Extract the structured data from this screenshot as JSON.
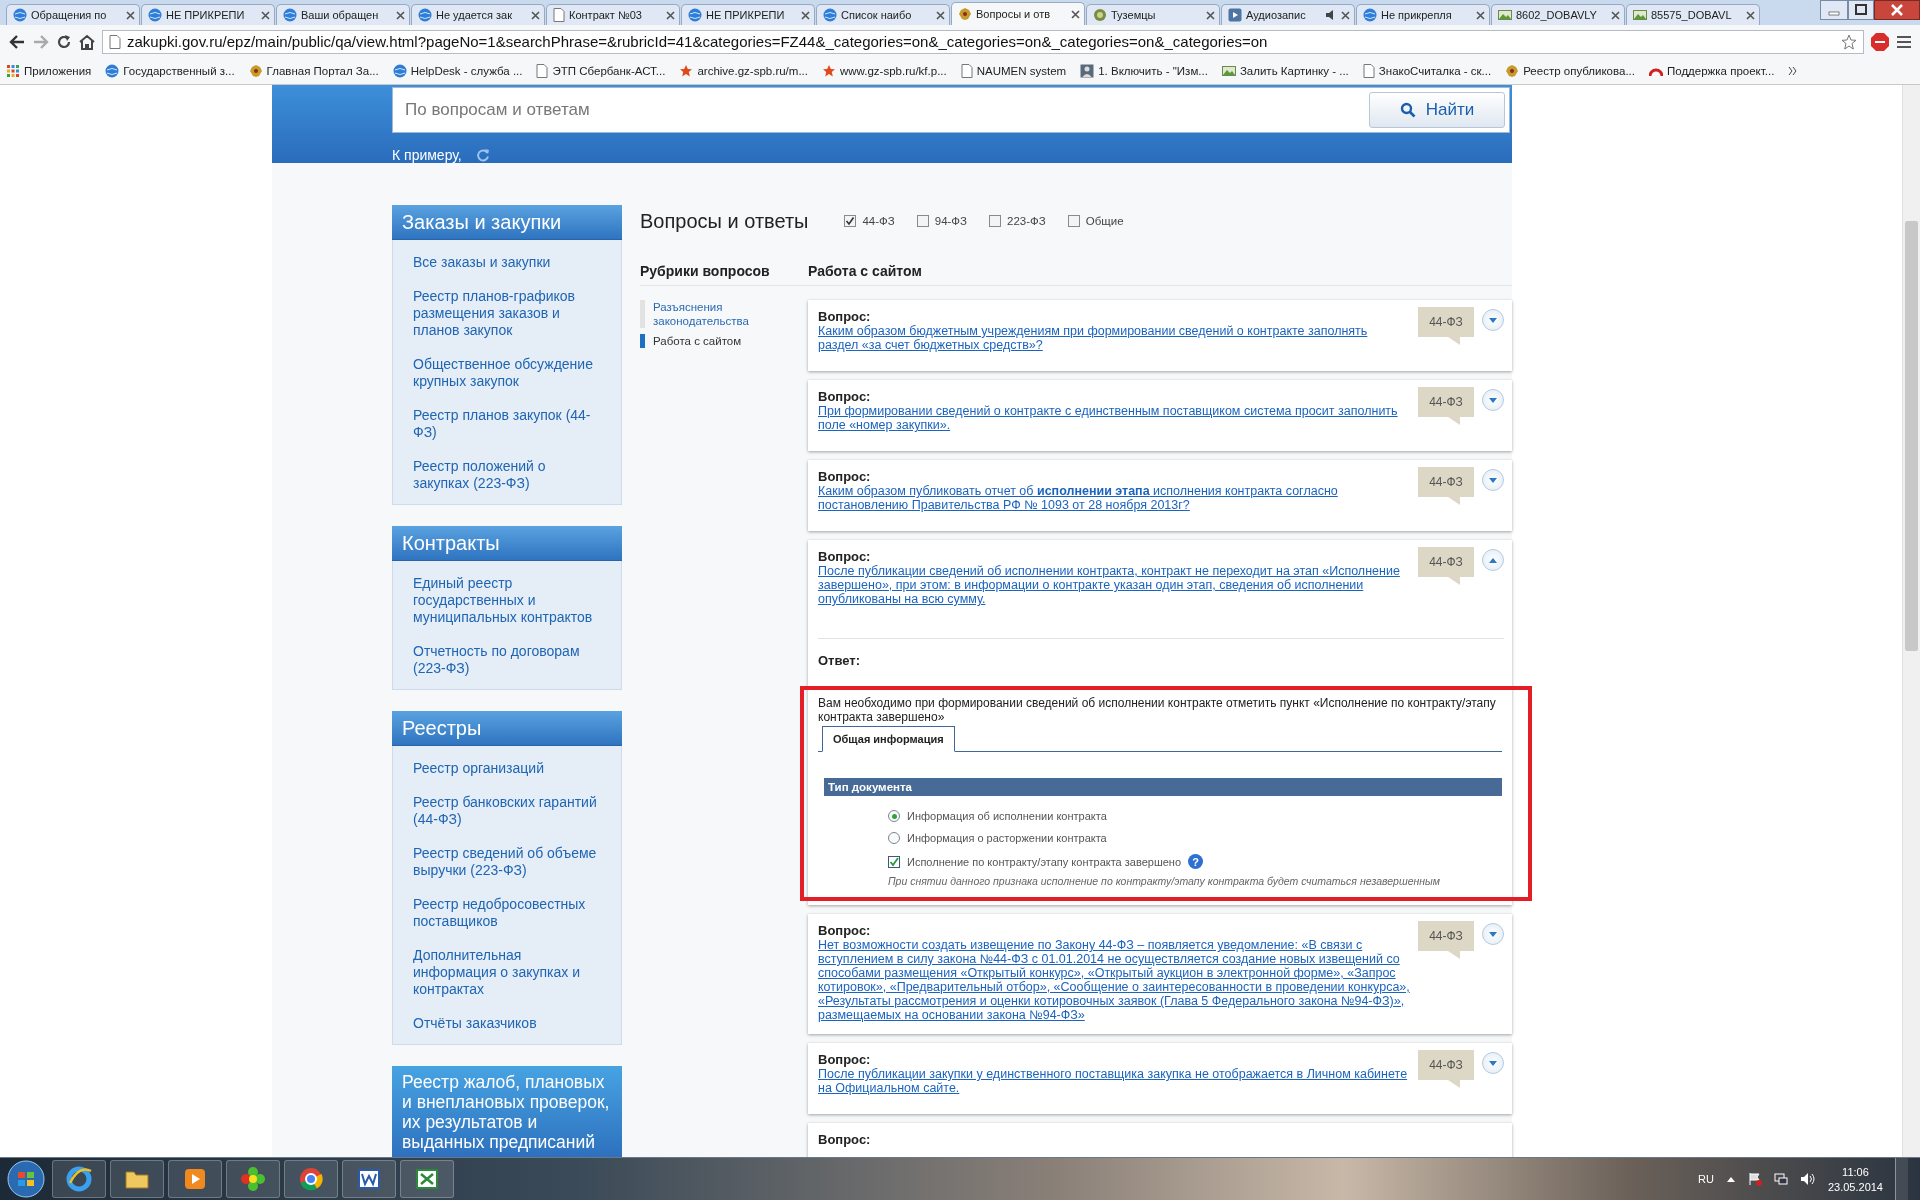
{
  "browser": {
    "tabs": [
      {
        "label": "Обращения по",
        "selected": false
      },
      {
        "label": "НЕ ПРИКРЕПИ",
        "selected": false
      },
      {
        "label": "Ваши обращен",
        "selected": false
      },
      {
        "label": "Не удается зак",
        "selected": false
      },
      {
        "label": "Контракт №03",
        "selected": false
      },
      {
        "label": "НЕ ПРИКРЕПИ",
        "selected": false
      },
      {
        "label": "Список наибо",
        "selected": false
      },
      {
        "label": "Вопросы и отв",
        "selected": true
      },
      {
        "label": "Туземцы",
        "selected": false
      },
      {
        "label": "Аудиозапис",
        "selected": false
      },
      {
        "label": "Не прикрепля",
        "selected": false
      },
      {
        "label": "8602_DOBAVLY",
        "selected": false
      },
      {
        "label": "85575_DOBAVL",
        "selected": false
      }
    ],
    "url": "zakupki.gov.ru/epz/main/public/qa/view.html?pageNo=1&searchPhrase=&rubricId=41&categories=FZ44&_categories=on&_categories=on&_categories=on&_categories=on",
    "bookmarks": [
      "Приложения",
      "Государственный з...",
      "Главная Портал За...",
      "HelpDesk - служба ...",
      "ЭТП Сбербанк-АСТ...",
      "archive.gz-spb.ru/m...",
      "www.gz-spb.ru/kf.p...",
      "NAUMEN system",
      "1. Включить - \"Изм...",
      "Залить Картинку - ...",
      "ЗнакоСчиталка - ск...",
      "Реестр опубликова...",
      "Поддержка проект..."
    ]
  },
  "header": {
    "search": {
      "placeholder": "По вопросам и ответам",
      "button": "Найти"
    },
    "example_label": "К примеру,"
  },
  "sidebar": [
    {
      "title": "Заказы и закупки",
      "items": [
        "Все заказы и закупки",
        "Реестр планов-графиков размещения заказов и планов закупок",
        "Общественное обсуждение крупных закупок",
        "Реестр планов закупок (44-ФЗ)",
        "Реестр положений о закупках (223-ФЗ)"
      ]
    },
    {
      "title": "Контракты",
      "items": [
        "Единый реестр государственных и муниципальных контрактов",
        "Отчетность по договорам (223-ФЗ)"
      ]
    },
    {
      "title": "Реестры",
      "items": [
        "Реестр организаций",
        "Реестр банковских гарантий (44-ФЗ)",
        "Реестр сведений об объеме выручки (223-ФЗ)",
        "Реестр недобросовестных поставщиков",
        "Дополнительная информация о закупках и контрактах",
        "Отчёты заказчиков"
      ]
    },
    {
      "title": "Реестр жалоб, плановых и внеплановых проверок, их результатов и выданных предписаний"
    }
  ],
  "main": {
    "title": "Вопросы и ответы",
    "filters": [
      {
        "label": "44-ФЗ",
        "checked": true
      },
      {
        "label": "94-ФЗ",
        "checked": false
      },
      {
        "label": "223-ФЗ",
        "checked": false
      },
      {
        "label": "Общие",
        "checked": false
      }
    ],
    "rubrics_heading": "Рубрики вопросов",
    "rubrics": [
      {
        "label": "Разъяснения законодательства",
        "selected": false
      },
      {
        "label": "Работа с сайтом",
        "selected": true
      }
    ],
    "section_heading": "Работа с сайтом",
    "questions": [
      {
        "label": "Вопрос:",
        "text": "Каким образом бюджетным учреждениям при формировании сведений о контракте заполнять раздел «за счет бюджетных средств»?",
        "tag": "44-ФЗ",
        "expanded": false
      },
      {
        "label": "Вопрос:",
        "text": "При формировании сведений о контракте с единственным поставщиком система просит заполнить поле «номер закупки».",
        "tag": "44-ФЗ",
        "expanded": false
      },
      {
        "label": "Вопрос:",
        "text": "Каким образом публиковать отчет об **исполнении этапа** исполнения контракта согласно постановлению Правительства РФ № 1093 от 28 ноября 2013г?",
        "tag": "44-ФЗ",
        "expanded": false
      },
      {
        "label": "Вопрос:",
        "text": "После публикации сведений об исполнении контракта, контракт не переходит на этап «Исполнение завершено», при этом: в информации о контракте указан один этап, сведения об исполнении опубликованы на всю сумму.",
        "tag": "44-ФЗ",
        "expanded": true,
        "answer": {
          "label": "Ответ:",
          "text": "Вам необходимо при формировании сведений об исполнении контракте отметить пункт «Исполнение по контракту/этапу контракта завершено»",
          "highlighted": true,
          "screenshot": {
            "tab": "Общая информация",
            "section": "Тип документа",
            "options": [
              {
                "label": "Информация об исполнении контракта",
                "selected": true
              },
              {
                "label": "Информация о расторжении контракта",
                "selected": false
              }
            ],
            "checkbox": {
              "label": "Исполнение по контракту/этапу контракта завершено",
              "checked": true,
              "help": "?"
            },
            "hint": "При снятии данного признака исполнение по контракту/этапу контракта будет считаться незавершенным"
          }
        }
      },
      {
        "label": "Вопрос:",
        "text": "Нет возможности создать извещение по Закону 44-ФЗ – появляется уведомление: «В связи с вступлением в силу закона №44-ФЗ с 01.01.2014 не осуществляется создание новых извещений со способами размещения «Открытый конкурс», «Открытый аукцион в электронной форме», «Запрос котировок», «Предварительный отбор», «Сообщение о заинтересованности в проведении конкурса», «Результаты рассмотрения и оценки котировочных заявок (Глава 5 Федерального закона №94-ФЗ)», размещаемых на основании закона №94-ФЗ»",
        "tag": "44-ФЗ",
        "expanded": false
      },
      {
        "label": "Вопрос:",
        "text": "После публикации закупки у единственного поставщика закупка не отображается в Личном кабинете на Официальном сайте.",
        "tag": "44-ФЗ",
        "expanded": false
      },
      {
        "label": "Вопрос:"
      }
    ]
  },
  "taskbar": {
    "language": "RU",
    "time": "11:06",
    "date": "23.05.2014"
  }
}
